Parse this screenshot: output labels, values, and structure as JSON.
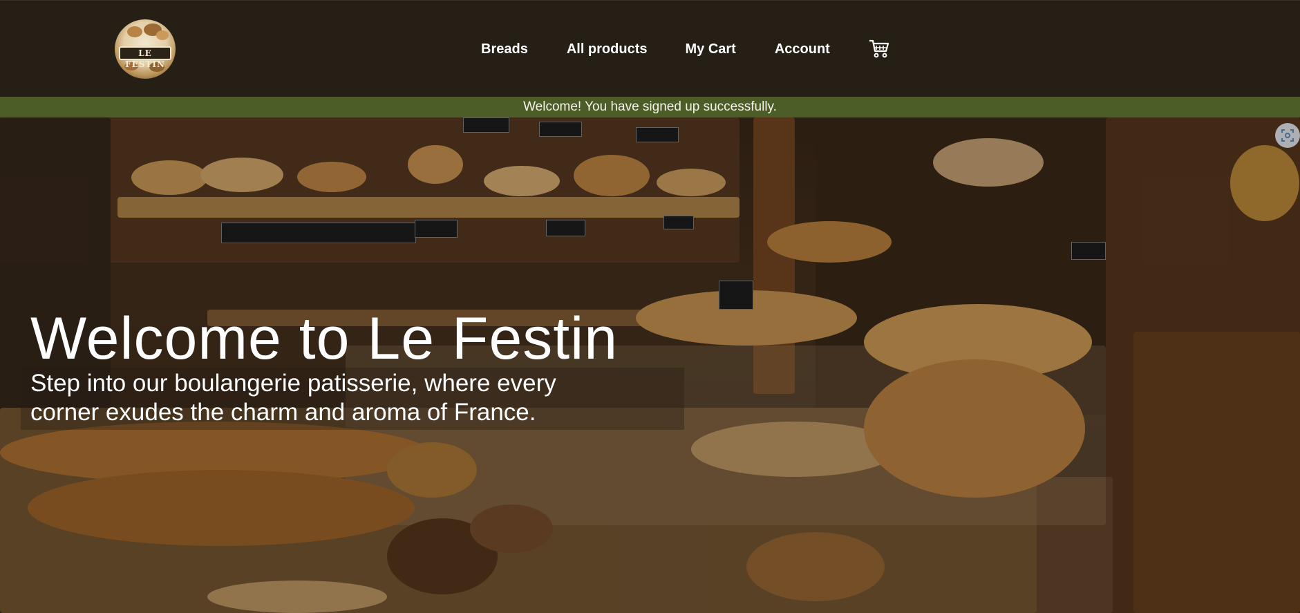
{
  "brand": {
    "logo_text": "LE FESTIN"
  },
  "nav": {
    "items": [
      {
        "label": "Breads"
      },
      {
        "label": "All products"
      },
      {
        "label": "My Cart"
      },
      {
        "label": "Account"
      }
    ],
    "cart_icon": "cart-icon"
  },
  "flash": {
    "message": "Welcome! You have signed up successfully."
  },
  "hero": {
    "title": "Welcome to Le Festin",
    "subtitle": "Step into our boulangerie patisserie, where every corner exudes the charm and aroma of France.",
    "image_description_icon": "expand-image-icon"
  },
  "colors": {
    "navbar_bg": "#261f15",
    "flash_bg": "#4d5d28",
    "text": "#ffffff"
  }
}
